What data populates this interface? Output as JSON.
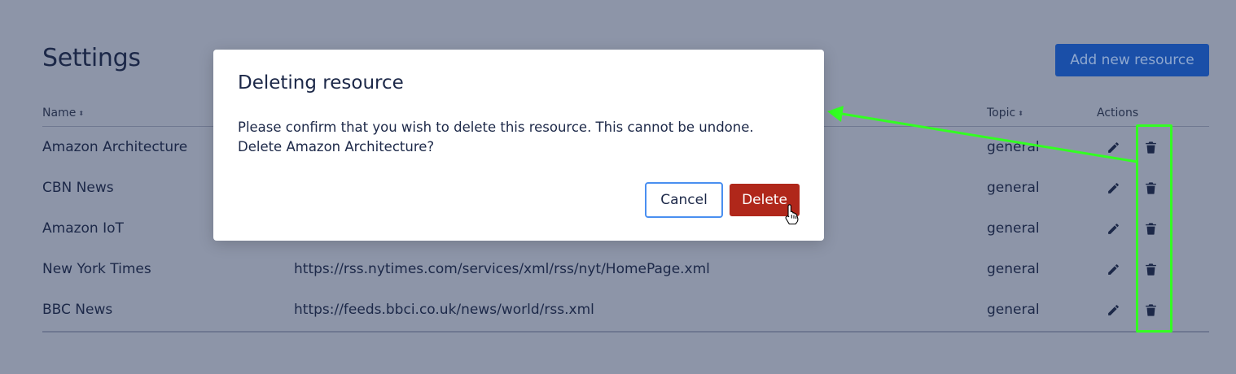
{
  "page": {
    "title": "Settings",
    "add_button_label": "Add new resource"
  },
  "table": {
    "columns": {
      "name": "Name",
      "topic": "Topic",
      "actions": "Actions"
    },
    "sort_glyph": "⬍",
    "rows": [
      {
        "name": "Amazon Architecture",
        "url": "",
        "topic": "general"
      },
      {
        "name": "CBN News",
        "url": "",
        "topic": "general"
      },
      {
        "name": "Amazon IoT",
        "url": "",
        "topic": "general"
      },
      {
        "name": "New York Times",
        "url": "https://rss.nytimes.com/services/xml/rss/nyt/HomePage.xml",
        "topic": "general"
      },
      {
        "name": "BBC News",
        "url": "https://feeds.bbci.co.uk/news/world/rss.xml",
        "topic": "general"
      }
    ],
    "icons": {
      "edit": "pencil-icon",
      "delete": "trash-icon"
    }
  },
  "modal": {
    "title": "Deleting resource",
    "body_line1": "Please confirm that you wish to delete this resource. This cannot be undone.",
    "body_line2": "Delete Amazon Architecture?",
    "cancel_label": "Cancel",
    "delete_label": "Delete"
  },
  "colors": {
    "backdrop": "#8d95a8",
    "primary": "#1a4fa8",
    "danger": "#b0271a",
    "focus_ring": "#4a8ff0",
    "annotation": "#33ff22"
  }
}
